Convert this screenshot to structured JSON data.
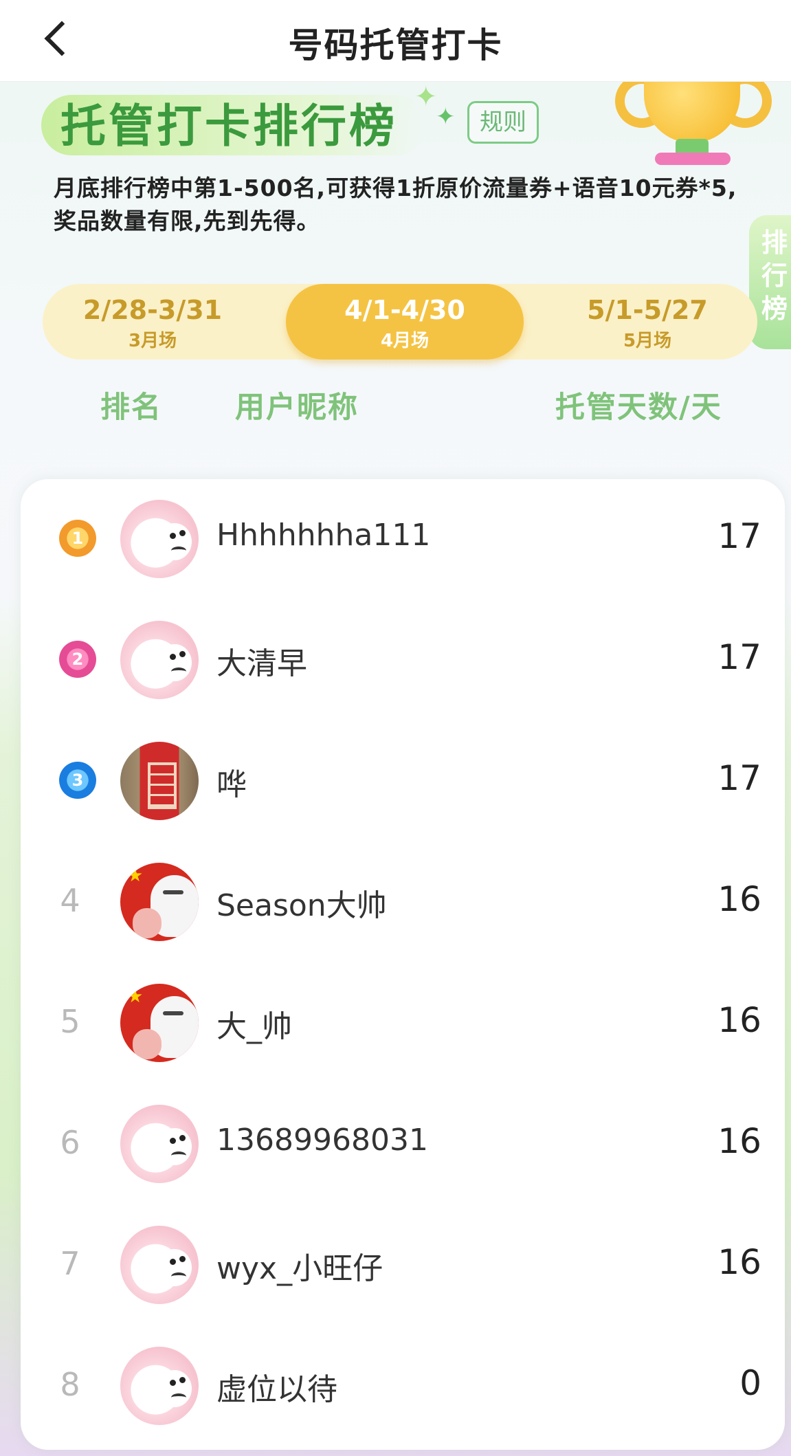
{
  "topbar": {
    "title": "号码托管打卡"
  },
  "hero": {
    "title": "托管打卡排行榜",
    "rules_label": "规则",
    "description": "月底排行榜中第1-500名,可获得1折原价流量券+语音10元券*5,奖品数量有限,先到先得。",
    "side_tab": "排行榜"
  },
  "periods": [
    {
      "range": "2/28-3/31",
      "label": "3月场",
      "active": false
    },
    {
      "range": "4/1-4/30",
      "label": "4月场",
      "active": true
    },
    {
      "range": "5/1-5/27",
      "label": "5月场",
      "active": false
    }
  ],
  "columns": {
    "rank": "排名",
    "nickname": "用户昵称",
    "days": "托管天数/天"
  },
  "leaderboard": [
    {
      "rank": "1",
      "nickname": "Hhhhhhha111",
      "days": "17",
      "avatar": "monkey-avatar",
      "badge": "gold-medal"
    },
    {
      "rank": "2",
      "nickname": "大清早",
      "days": "17",
      "avatar": "monkey-avatar",
      "badge": "pink-medal"
    },
    {
      "rank": "3",
      "nickname": "哗",
      "days": "17",
      "avatar": "phone-booth-photo",
      "badge": "blue-medal"
    },
    {
      "rank": "4",
      "nickname": "Season大帅",
      "days": "16",
      "avatar": "flag-robot-avatar"
    },
    {
      "rank": "5",
      "nickname": "大_帅",
      "days": "16",
      "avatar": "flag-robot-avatar"
    },
    {
      "rank": "6",
      "nickname": "13689968031",
      "days": "16",
      "avatar": "monkey-avatar"
    },
    {
      "rank": "7",
      "nickname": "wyx_小旺仔",
      "days": "16",
      "avatar": "monkey-avatar"
    },
    {
      "rank": "8",
      "nickname": "虚位以待",
      "days": "0",
      "avatar": "monkey-avatar"
    }
  ],
  "colors": {
    "accent_yellow": "#f5c343",
    "accent_green": "#7fc37a",
    "title_green": "#3b9a3d"
  }
}
